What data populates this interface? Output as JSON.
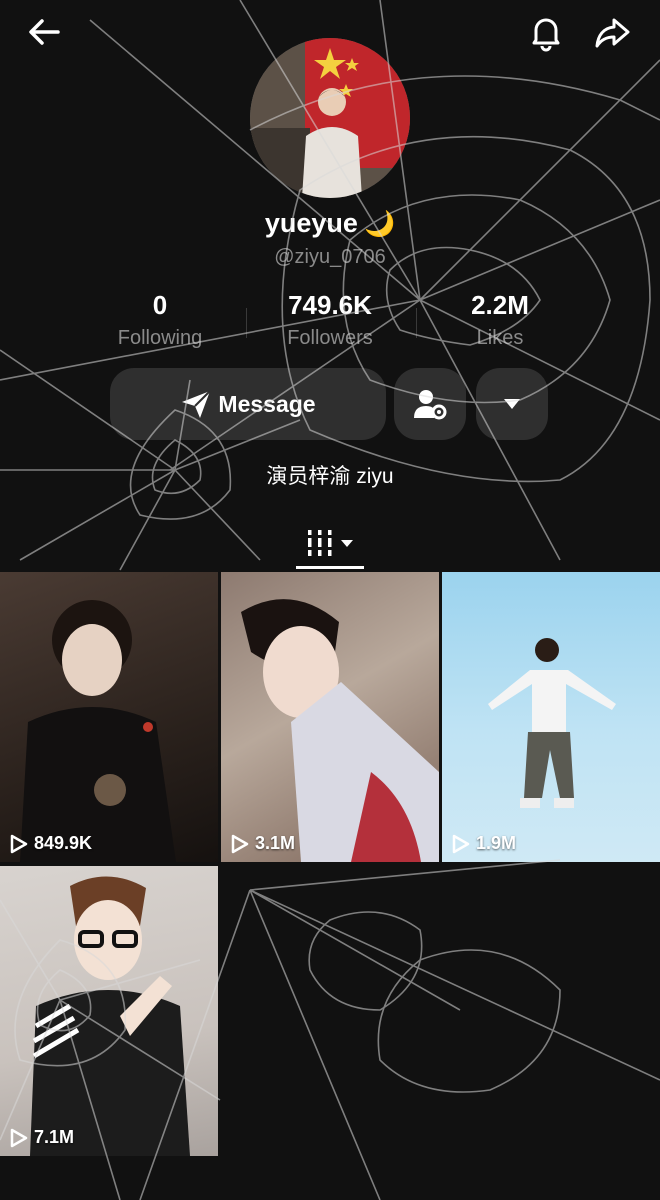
{
  "header": {
    "back_icon": "back-arrow-icon",
    "bell_icon": "bell-icon",
    "share_icon": "share-icon"
  },
  "profile": {
    "username": "yueyue",
    "emoji": "🌙",
    "handle": "@ziyu_0706",
    "bio": "演员梓渝 ziyu"
  },
  "stats": [
    {
      "value": "0",
      "label": "Following"
    },
    {
      "value": "749.6K",
      "label": "Followers"
    },
    {
      "value": "2.2M",
      "label": "Likes"
    }
  ],
  "actions": {
    "message_label": "Message",
    "add_friend_icon": "person-settings-icon",
    "more_icon": "triangle-down-icon"
  },
  "tabs": {
    "grid_icon": "grid-icon",
    "dropdown_icon": "caret-down-icon"
  },
  "videos": [
    {
      "views": "849.9K"
    },
    {
      "views": "3.1M"
    },
    {
      "views": "1.9M"
    },
    {
      "views": "7.1M"
    }
  ],
  "colors": {
    "background": "#111111",
    "button": "#2f2f2f",
    "muted_text": "#8a8a8a",
    "accent_moon": "#f2c94c"
  }
}
